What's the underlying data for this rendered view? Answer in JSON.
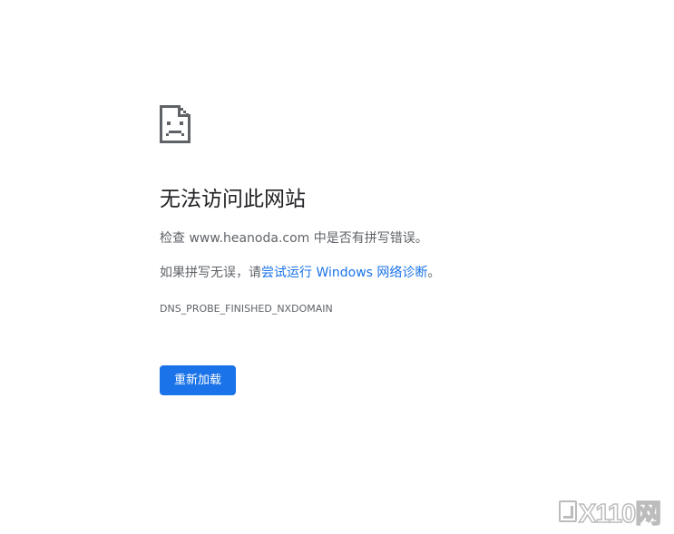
{
  "error_page": {
    "title": "无法访问此网站",
    "line1_prefix": "检查 ",
    "domain": "www.heanoda.com",
    "line1_suffix": " 中是否有拼写错误。",
    "line2_prefix": "如果拼写无误，请",
    "diagnostics_link": "尝试运行 Windows 网络诊断",
    "line2_suffix": "。",
    "error_code": "DNS_PROBE_FINISHED_NXDOMAIN",
    "reload_label": "重新加载",
    "icon": "sad-document-icon"
  },
  "watermark": {
    "text": "X110网"
  },
  "colors": {
    "accent": "#1a73e8",
    "text_primary": "#202124",
    "text_secondary": "#5f6368",
    "background": "#ffffff"
  }
}
